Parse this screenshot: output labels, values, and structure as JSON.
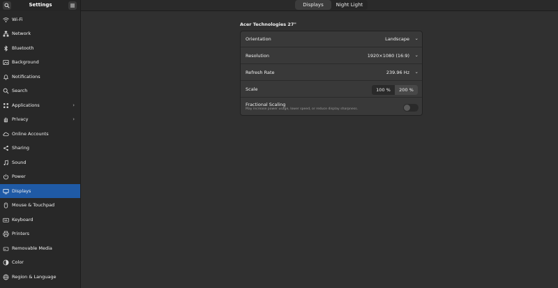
{
  "app": {
    "title": "Settings"
  },
  "header": {
    "search_icon": "search-icon",
    "menu_icon": "hamburger-menu-icon",
    "tabs": [
      {
        "label": "Displays",
        "active": true
      },
      {
        "label": "Night Light",
        "active": false
      }
    ]
  },
  "sidebar": {
    "items": [
      {
        "label": "Wi-Fi",
        "icon": "wifi-icon"
      },
      {
        "label": "Network",
        "icon": "network-icon"
      },
      {
        "label": "Bluetooth",
        "icon": "bluetooth-icon"
      },
      {
        "label": "Background",
        "icon": "background-icon"
      },
      {
        "label": "Notifications",
        "icon": "bell-icon"
      },
      {
        "label": "Search",
        "icon": "search-icon"
      },
      {
        "label": "Applications",
        "icon": "apps-grid-icon",
        "chevron": "›"
      },
      {
        "label": "Privacy",
        "icon": "hand-icon",
        "chevron": "›"
      },
      {
        "label": "Online Accounts",
        "icon": "cloud-icon"
      },
      {
        "label": "Sharing",
        "icon": "share-icon"
      },
      {
        "label": "Sound",
        "icon": "music-note-icon"
      },
      {
        "label": "Power",
        "icon": "power-icon"
      },
      {
        "label": "Displays",
        "icon": "monitor-icon",
        "selected": true
      },
      {
        "label": "Mouse & Touchpad",
        "icon": "mouse-icon"
      },
      {
        "label": "Keyboard",
        "icon": "keyboard-icon"
      },
      {
        "label": "Printers",
        "icon": "printer-icon"
      },
      {
        "label": "Removable Media",
        "icon": "usb-drive-icon"
      },
      {
        "label": "Color",
        "icon": "color-icon"
      },
      {
        "label": "Region & Language",
        "icon": "globe-icon"
      }
    ],
    "selected_color": "#1f5aa6"
  },
  "main": {
    "monitor_name": "Acer Technologies 27\"",
    "rows": {
      "orientation": {
        "label": "Orientation",
        "value": "Landscape"
      },
      "resolution": {
        "label": "Resolution",
        "value": "1920×1080 (16:9)"
      },
      "refresh": {
        "label": "Refresh Rate",
        "value": "239.96 Hz"
      },
      "scale": {
        "label": "Scale",
        "options": [
          "100 %",
          "200 %"
        ],
        "selected": "200 %"
      },
      "fractional": {
        "label": "Fractional Scaling",
        "sublabel": "May increase power usage, lower speed, or reduce display sharpness.",
        "enabled": false
      }
    }
  }
}
